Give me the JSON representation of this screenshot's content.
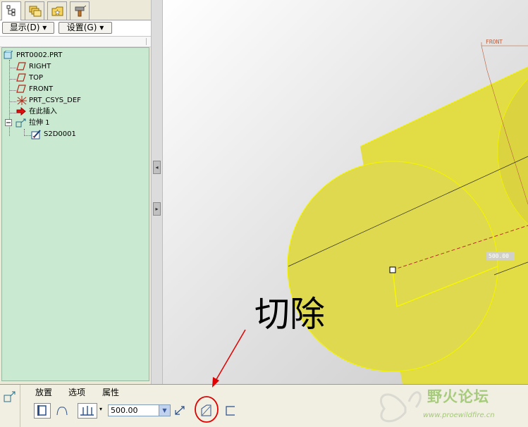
{
  "navigator": {
    "tabs": [
      {
        "id": "model-tree",
        "icon": "model-tree-icon"
      },
      {
        "id": "layers",
        "icon": "folder-layers-icon"
      },
      {
        "id": "favorites",
        "icon": "favorites-folder-icon"
      },
      {
        "id": "connections",
        "icon": "tools-icon"
      }
    ],
    "show_menu": "显示(D)",
    "settings_menu": "设置(G)",
    "tree": {
      "root": "PRT0002.PRT",
      "items": [
        {
          "label": "RIGHT",
          "icon": "datum-plane-icon"
        },
        {
          "label": "TOP",
          "icon": "datum-plane-icon"
        },
        {
          "label": "FRONT",
          "icon": "datum-plane-icon"
        },
        {
          "label": "PRT_CSYS_DEF",
          "icon": "coordinate-system-icon"
        },
        {
          "label": "在此插入",
          "icon": "insert-here-arrow-icon"
        },
        {
          "label": "拉伸 1",
          "icon": "extrude-feature-icon"
        },
        {
          "label": "S2D0001",
          "icon": "sketch-icon"
        }
      ],
      "expander": "−"
    }
  },
  "viewport": {
    "datum_label": "FRONT",
    "dimension": "500.00",
    "model_color": "#e3de4a",
    "edge_color": "#f2f200"
  },
  "dashboard": {
    "tabs": [
      "放置",
      "选项",
      "属性"
    ],
    "depth_value": "500.00"
  },
  "annotation": {
    "label": "切除",
    "color": "#e00000"
  },
  "watermark": {
    "name": "野火论坛",
    "url": "www.proewildfire.cn"
  }
}
